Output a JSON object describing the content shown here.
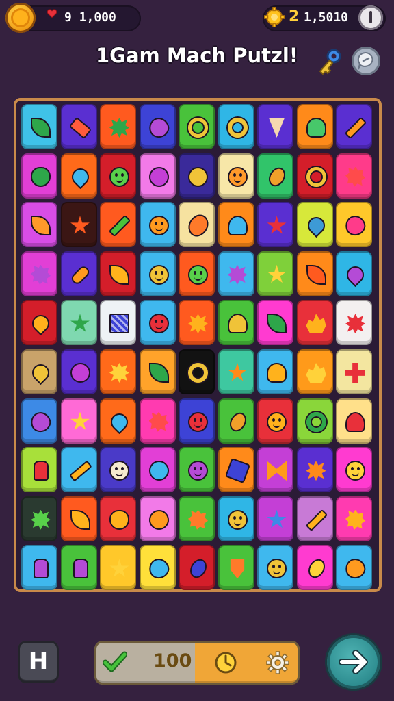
{
  "header": {
    "left_count": "9 1,000",
    "right_level": "2",
    "right_count": "1,5010"
  },
  "title": "1Gam Mach Putzl!",
  "board": {
    "rows": 10,
    "cols": 9,
    "tiles": [
      [
        [
          "#3fc2e8",
          "leaf",
          "#2ea64a"
        ],
        [
          "#5a2fd1",
          "candy",
          "#ff5b3b"
        ],
        [
          "#ff5a1f",
          "splat",
          "#2ea64a"
        ],
        [
          "#3d43d6",
          "balloon",
          "#b44bd6"
        ],
        [
          "#49c23b",
          "swirl",
          "#f0c338"
        ],
        [
          "#2fb6e6",
          "ring",
          "#f0c338"
        ],
        [
          "#5a2fd1",
          "cone",
          "#f5d7b0"
        ],
        [
          "#ff8a1a",
          "bulb",
          "#47c86a"
        ],
        [
          "#5a2fd1",
          "pencil",
          "#ff9a1f"
        ]
      ],
      [
        [
          "#e23fd6",
          "apple",
          "#2ea64a"
        ],
        [
          "#ff6a1a",
          "drop",
          "#3fb8ee"
        ],
        [
          "#d41e2a",
          "face",
          "#58d04a"
        ],
        [
          "#f27ae8",
          "circle",
          "#c43fd6"
        ],
        [
          "#3a2a9a",
          "circle",
          "#f0c338"
        ],
        [
          "#f7e7a8",
          "face",
          "#ff9a2a"
        ],
        [
          "#31c46a",
          "lemon",
          "#f0a02a"
        ],
        [
          "#d41e2a",
          "swirl",
          "#f0c338"
        ],
        [
          "#ff3b8a",
          "flower",
          "#ff4b4b"
        ]
      ],
      [
        [
          "#d84de6",
          "leaf",
          "#ff9a2a"
        ],
        [
          "#3b1614",
          "star",
          "#ff5a1f"
        ],
        [
          "#ff5a1f",
          "stick",
          "#49c23b"
        ],
        [
          "#3fb8ee",
          "face",
          "#ff9a1f"
        ],
        [
          "#f6e2a0",
          "pepper",
          "#ff7a2a"
        ],
        [
          "#ff8a1a",
          "heart",
          "#3fb8ee"
        ],
        [
          "#5a2fd1",
          "star",
          "#e8303a"
        ],
        [
          "#d7e83a",
          "drop",
          "#3d9ad6"
        ],
        [
          "#ffc82a",
          "balloon",
          "#ff3b8a"
        ]
      ],
      [
        [
          "#e23fd6",
          "flower",
          "#b44bd6"
        ],
        [
          "#5a2fd1",
          "bread",
          "#ff9a1f"
        ],
        [
          "#d41e2a",
          "leaf",
          "#ffb21c"
        ],
        [
          "#3fb8ee",
          "face",
          "#f0c338"
        ],
        [
          "#ff5a1f",
          "face",
          "#58d04a"
        ],
        [
          "#3fb8ee",
          "splat",
          "#b44bd6"
        ],
        [
          "#7fd03a",
          "star",
          "#ffd23a"
        ],
        [
          "#ff8a1a",
          "leaf",
          "#ff5a1f"
        ],
        [
          "#2fb6e6",
          "drop",
          "#b44bd6"
        ]
      ],
      [
        [
          "#d41e2a",
          "drop",
          "#ffb21c"
        ],
        [
          "#7fd8b0",
          "star",
          "#2ea64a"
        ],
        [
          "#eef2f5",
          "stripes",
          "#3d43d6"
        ],
        [
          "#3fb8ee",
          "face",
          "#e8303a"
        ],
        [
          "#ff5a1f",
          "splat",
          "#ffb21c"
        ],
        [
          "#49c23b",
          "heart",
          "#f0c338"
        ],
        [
          "#ff3bd0",
          "leaf",
          "#2ea64a"
        ],
        [
          "#e8303a",
          "flame",
          "#ffb21c"
        ],
        [
          "#f3f0f0",
          "splat",
          "#e8303a"
        ]
      ],
      [
        [
          "#c9a36a",
          "drop",
          "#f0c338"
        ],
        [
          "#5a2fd1",
          "circle",
          "#c43fd6"
        ],
        [
          "#ff6a1a",
          "splat",
          "#ffd23a"
        ],
        [
          "#ffa32a",
          "leaf",
          "#2ea64a"
        ],
        [
          "#121212",
          "ring",
          "#f0c338"
        ],
        [
          "#3ec8a0",
          "star",
          "#ff8a1a"
        ],
        [
          "#3fb8ee",
          "bulb",
          "#ffb21c"
        ],
        [
          "#ff9a1a",
          "flame",
          "#ffd23a"
        ],
        [
          "#f3e6a0",
          "cross",
          "#e8303a"
        ]
      ],
      [
        [
          "#3d8ae6",
          "balloon",
          "#b44bd6"
        ],
        [
          "#ff6ad6",
          "star",
          "#ffd23a"
        ],
        [
          "#ff6a1a",
          "drop",
          "#3fb8ee"
        ],
        [
          "#ff3bb0",
          "flower",
          "#ff4b4b"
        ],
        [
          "#3d43d6",
          "face",
          "#e8303a"
        ],
        [
          "#49c23b",
          "lemon",
          "#f0a02a"
        ],
        [
          "#e8303a",
          "face",
          "#ffb21c"
        ],
        [
          "#8ad63a",
          "ring",
          "#2ea64a"
        ],
        [
          "#ffe08a",
          "heart",
          "#e8303a"
        ]
      ],
      [
        [
          "#a8e03a",
          "bottle",
          "#e8303a"
        ],
        [
          "#3fb8ee",
          "hammer",
          "#ffb21c"
        ],
        [
          "#4a3ac8",
          "face",
          "#f5ead0"
        ],
        [
          "#e23fd6",
          "circle",
          "#3fb8ee"
        ],
        [
          "#49c23b",
          "face",
          "#b44bd6"
        ],
        [
          "#ff8a1a",
          "box",
          "#3d43d6"
        ],
        [
          "#c43fd6",
          "bow",
          "#ff9a1a"
        ],
        [
          "#5a2fd1",
          "splat",
          "#ff8a1a"
        ],
        [
          "#ff3bd0",
          "face",
          "#ffd23a"
        ]
      ],
      [
        [
          "#2a3a30",
          "splat",
          "#58d04a"
        ],
        [
          "#ff5a1f",
          "leaf",
          "#ffb21c"
        ],
        [
          "#e8303a",
          "apple",
          "#ffb21c"
        ],
        [
          "#f27ae8",
          "circle",
          "#ff9a1f"
        ],
        [
          "#49c23b",
          "flower",
          "#ff7a2a"
        ],
        [
          "#2fb6e6",
          "face",
          "#f0c338"
        ],
        [
          "#c43fd6",
          "star",
          "#3d8ae6"
        ],
        [
          "#c87ad6",
          "stick",
          "#ffb21c"
        ],
        [
          "#ff3bb0",
          "flower",
          "#ffb21c"
        ]
      ],
      [
        [
          "#3fb8ee",
          "bottle",
          "#b44bd6"
        ],
        [
          "#49c23b",
          "bottle",
          "#b44bd6"
        ],
        [
          "#ffc82a",
          "star",
          "#ffd23a"
        ],
        [
          "#ffe03a",
          "balloon",
          "#3fb8ee"
        ],
        [
          "#d41e2a",
          "lemon",
          "#3d43d6"
        ],
        [
          "#49c23b",
          "icecream",
          "#ff7a2a"
        ],
        [
          "#3fb8ee",
          "face",
          "#f0c338"
        ],
        [
          "#ff3bd0",
          "lemon",
          "#ffd23a"
        ],
        [
          "#3fb8ee",
          "balloon",
          "#ff9a1f"
        ]
      ]
    ]
  },
  "bottom": {
    "hint_label": "H",
    "score": "100"
  },
  "colors": {
    "background": "#35213f",
    "board_frame": "#c98a4a",
    "accent_teal": "#2c8b8e"
  }
}
